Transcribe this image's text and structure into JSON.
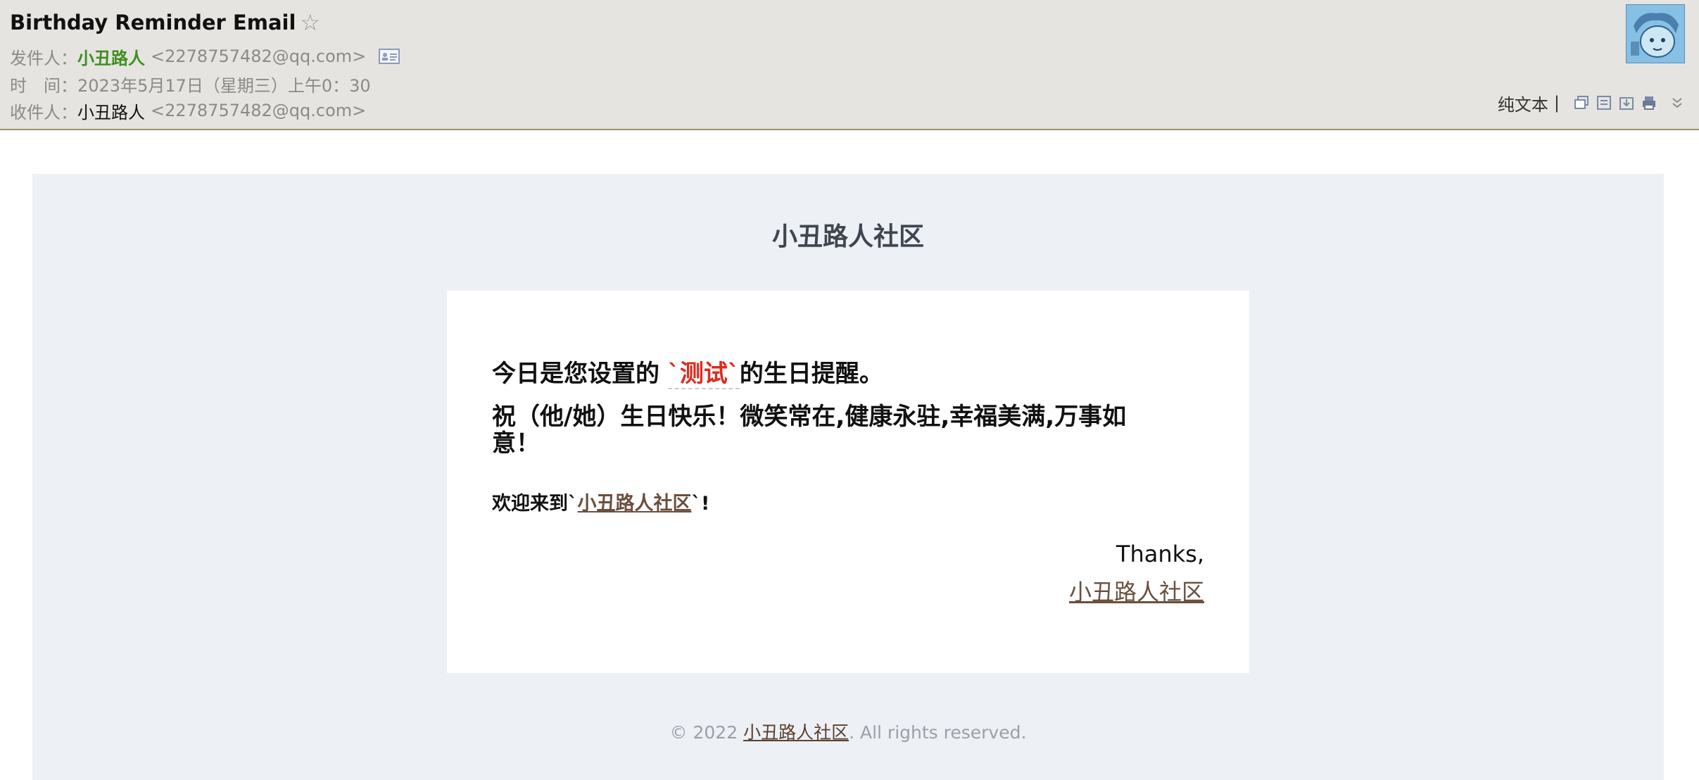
{
  "header": {
    "subject": "Birthday Reminder Email",
    "sender_label": "发件人：",
    "sender_name": "小丑路人",
    "sender_address": "<2278757482@qq.com>",
    "time_label": "时　间：",
    "time_value": "2023年5月17日（星期三）上午0：30",
    "recipient_label": "收件人：",
    "recipient_name": "小丑路人",
    "recipient_address": "<2278757482@qq.com>",
    "plain_text_label": "纯文本",
    "separator": "|"
  },
  "mail": {
    "community_title": "小丑路人社区",
    "line1_prefix": "今日是您设置的 ",
    "line1_highlight": "`测试`",
    "line1_suffix": "的生日提醒。",
    "line2": "祝（他/她）生日快乐！微笑常在,健康永驻,幸福美满,万事如意！",
    "line3_prefix": "欢迎来到`",
    "line3_link": "小丑路人社区",
    "line3_suffix": "`!",
    "thanks": "Thanks,",
    "signature_link": "小丑路人社区",
    "footer_prefix": "© 2022 ",
    "footer_link": "小丑路人社区",
    "footer_suffix": ". All rights reserved."
  },
  "icons": [
    "star-icon",
    "contact-card-icon",
    "avatar",
    "new-window-icon",
    "view-icon",
    "download-icon",
    "print-icon",
    "expand-icon"
  ],
  "colors": {
    "header_bg": "#e6e4e0",
    "sender_name": "#3f8f1f",
    "highlight": "#e02a1c",
    "link": "#6b4f3d",
    "mail_bg": "#edf0f5"
  }
}
